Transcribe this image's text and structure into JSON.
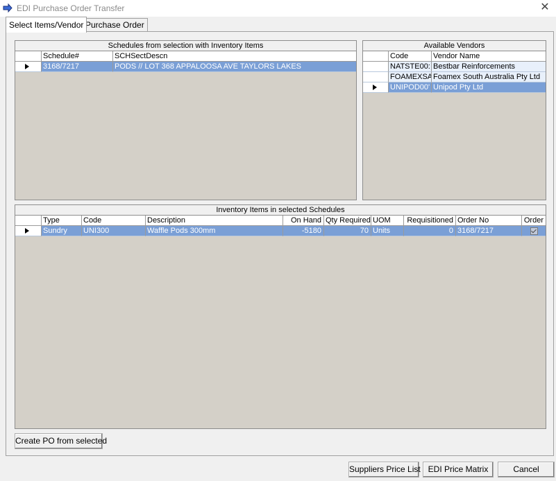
{
  "window": {
    "title": "EDI Purchase Order Transfer",
    "close_glyph": "✕"
  },
  "tabs": [
    {
      "label": "Select Items/Vendor"
    },
    {
      "label": "Purchase Order"
    }
  ],
  "schedules": {
    "title": "Schedules from selection with Inventory Items",
    "columns": [
      "Schedule#",
      "SCHSectDescn"
    ],
    "rows": [
      {
        "schedule": "3168/7217",
        "descn": "PODS // LOT 368 APPALOOSA AVE TAYLORS LAKES"
      }
    ]
  },
  "vendors": {
    "title": "Available Vendors",
    "columns": [
      "Code",
      "Vendor Name"
    ],
    "rows": [
      {
        "code": "NATSTE00:",
        "name": "Bestbar Reinforcements"
      },
      {
        "code": "FOAMEXSA",
        "name": "Foamex South Australia Pty Ltd"
      },
      {
        "code": "UNIPOD00'",
        "name": "Unipod Pty Ltd"
      }
    ]
  },
  "inventory": {
    "title": "Inventory Items in selected Schedules",
    "columns": [
      "Type",
      "Code",
      "Description",
      "On Hand",
      "Qty Required",
      "UOM",
      "Requisitioned",
      "Order No",
      "Order"
    ],
    "rows": [
      {
        "type": "Sundry",
        "code": "UNI300",
        "description": "Waffle Pods 300mm",
        "on_hand": "-5180",
        "qty_required": "70",
        "uom": "Units",
        "requisitioned": "0",
        "order_no": "3168/7217",
        "order": true
      }
    ]
  },
  "buttons": {
    "create_po": "Create PO from selected",
    "suppliers_price_list": "Suppliers Price List",
    "edi_price_matrix": "EDI Price Matrix",
    "cancel": "Cancel"
  }
}
